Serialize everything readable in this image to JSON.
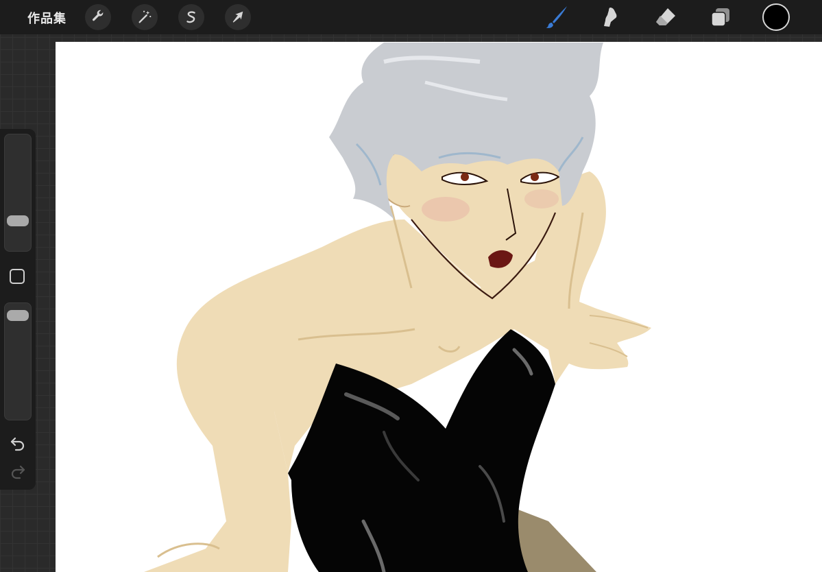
{
  "toolbar": {
    "gallery_label": "作品集",
    "left_tools": [
      {
        "name": "actions",
        "icon": "wrench-icon"
      },
      {
        "name": "adjustments",
        "icon": "magic-wand-icon"
      },
      {
        "name": "selection",
        "icon": "selection-s-icon"
      },
      {
        "name": "transform",
        "icon": "arrow-cursor-icon"
      }
    ],
    "right_tools": [
      {
        "name": "brush",
        "icon": "brush-icon",
        "active": true
      },
      {
        "name": "smudge",
        "icon": "smudge-finger-icon",
        "active": false
      },
      {
        "name": "eraser",
        "icon": "eraser-icon",
        "active": false
      },
      {
        "name": "layers",
        "icon": "layers-icon",
        "active": false
      }
    ],
    "current_color": "#000000"
  },
  "sidebar": {
    "brush_size_level": 0.22,
    "opacity_level": 0.95,
    "icons": [
      "square-modify-icon",
      "undo-icon",
      "redo-icon"
    ]
  },
  "colors": {
    "toolbar_bg": "#1c1c1c",
    "active_tool": "#3a7bd5",
    "icon": "#d6d6d6",
    "skin": "#efdcb6",
    "hair": "#c9ccd1",
    "outfit": "#050505"
  }
}
